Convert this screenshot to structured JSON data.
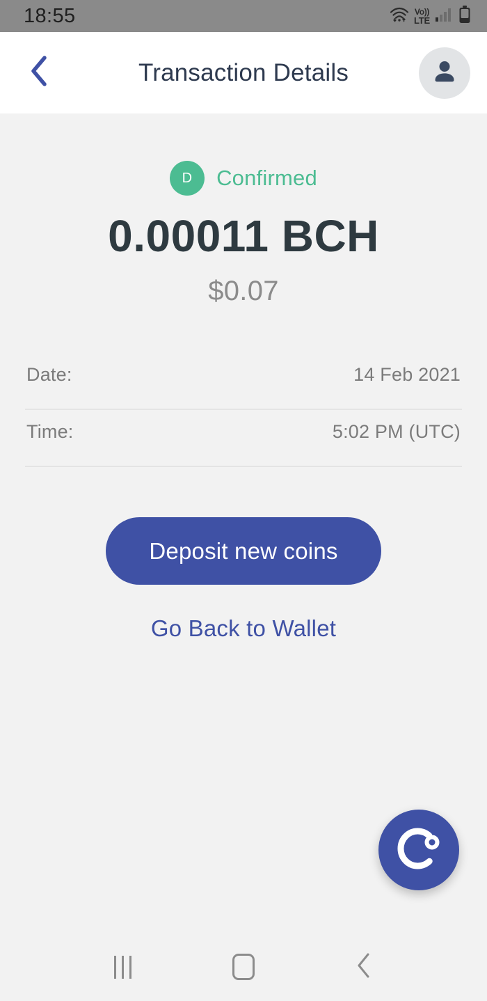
{
  "status_bar": {
    "time": "18:55",
    "icons": [
      "wifi-icon",
      "volte-icon",
      "signal-icon",
      "battery-icon"
    ],
    "volte_line1": "Vo))",
    "volte_line2": "LTE"
  },
  "header": {
    "back_icon": "chevron-left-icon",
    "title": "Transaction Details",
    "avatar_icon": "person-icon"
  },
  "transaction": {
    "type_letter": "D",
    "status": "Confirmed",
    "status_color": "#4cbc92",
    "amount": "0.00011 BCH",
    "fiat_amount": "$0.07",
    "details": [
      {
        "key": "Date:",
        "value": "14 Feb 2021"
      },
      {
        "key": "Time:",
        "value": "5:02 PM (UTC)"
      }
    ]
  },
  "actions": {
    "primary_label": "Deposit new coins",
    "primary_color": "#3f51a5",
    "link_label": "Go Back to Wallet"
  },
  "fab": {
    "icon": "support-chat-c-icon"
  },
  "nav_bar": {
    "recents_icon": "recents-icon",
    "home_icon": "home-icon",
    "back_icon": "back-chevron-icon"
  }
}
